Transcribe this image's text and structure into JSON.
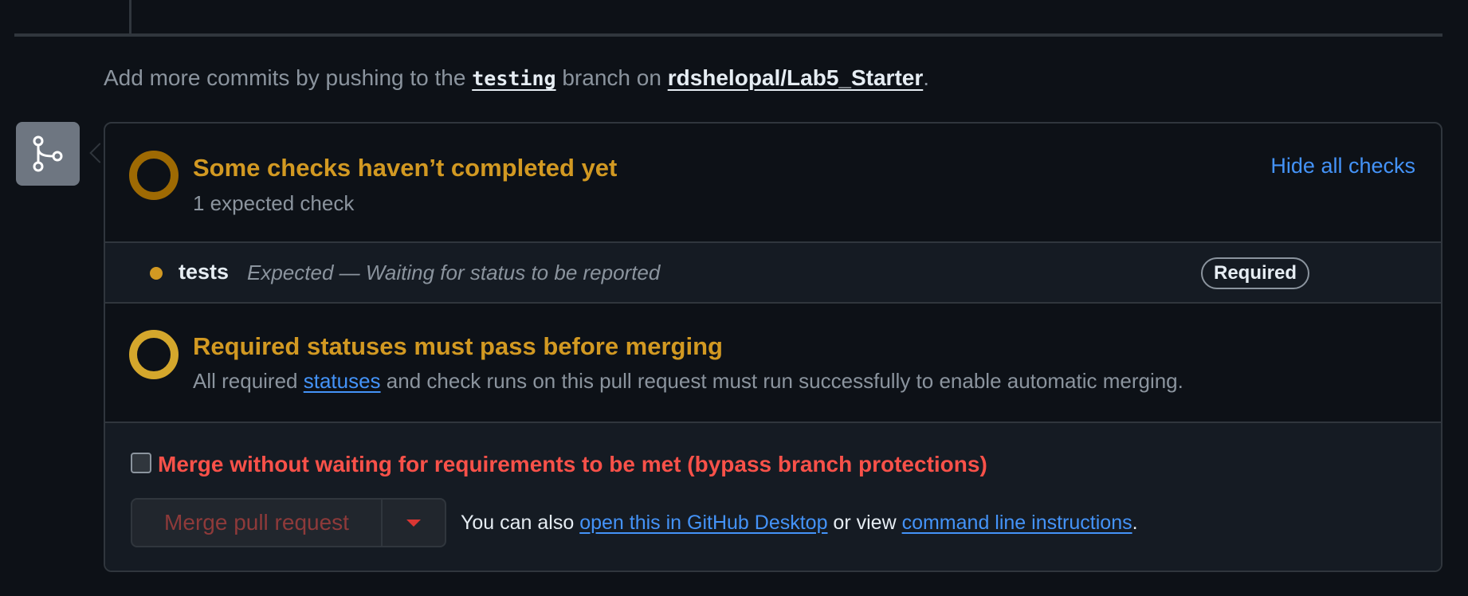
{
  "hint": {
    "prefix": "Add more commits by pushing to the ",
    "branch": "testing",
    "middle": " branch on ",
    "repo": "rdshelopal/Lab5_Starter",
    "suffix": "."
  },
  "checks": {
    "title": "Some checks haven’t completed yet",
    "subtitle": "1 expected check",
    "hide_label": "Hide all checks",
    "items": [
      {
        "name": "tests",
        "description": "Expected — Waiting for status to be reported",
        "badge": "Required"
      }
    ]
  },
  "statuses": {
    "title": "Required statuses must pass before merging",
    "text_before": "All required ",
    "link": "statuses",
    "text_after": " and check runs on this pull request must run successfully to enable automatic merging."
  },
  "merge": {
    "bypass_label": "Merge without waiting for requirements to be met (bypass branch protections)",
    "bypass_checked": false,
    "button_label": "Merge pull request",
    "also_prefix": "You can also ",
    "desktop_link": "open this in GitHub Desktop",
    "also_middle": " or view ",
    "cli_link": "command line instructions",
    "also_suffix": "."
  },
  "colors": {
    "pending": "#d29922",
    "link": "#4493f8",
    "danger": "#f85149",
    "background": "#0d1117"
  },
  "icons": {
    "badge": "git-branch-icon",
    "status": "pending-ring-icon",
    "caret": "triangle-down-icon"
  }
}
